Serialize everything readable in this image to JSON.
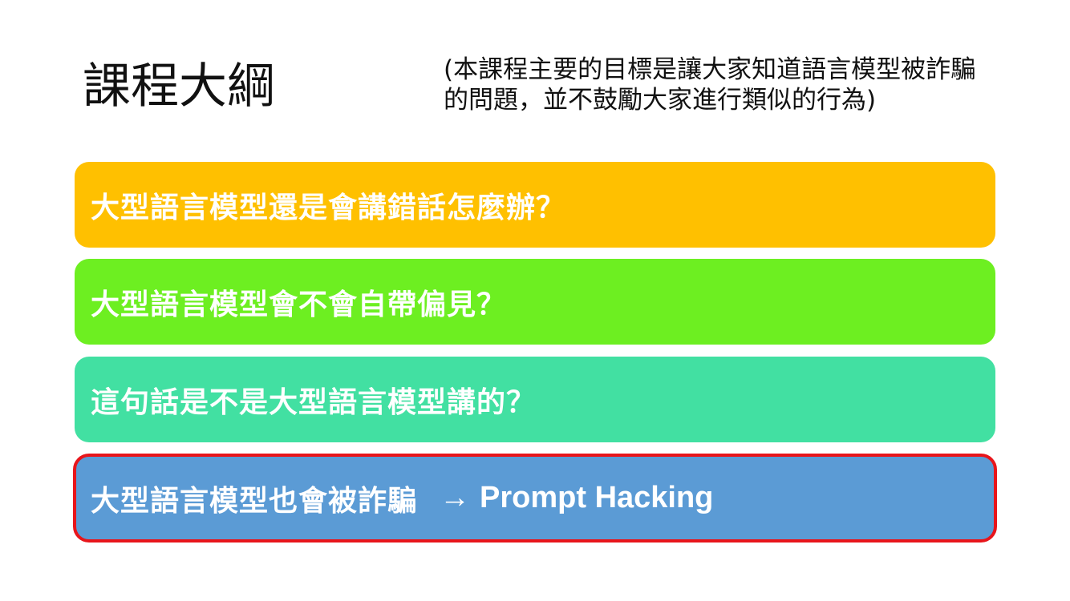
{
  "slide": {
    "title": "課程大綱",
    "note": {
      "line1": "(本課程主要的目標是讓大家知道語言模型被詐騙",
      "line2": "的問題，並不鼓勵大家進行類似的行為)"
    },
    "topics": [
      {
        "label": "大型語言模型還是會講錯話怎麼辦？",
        "color": "#ffc000"
      },
      {
        "label": "大型語言模型會不會自帶偏見？",
        "color": "#6def21"
      },
      {
        "label": "這句話是不是大型語言模型講的？",
        "color": "#42e0a2"
      },
      {
        "label": "大型語言模型也會被詐騙",
        "arrow": "→",
        "extra": "Prompt Hacking",
        "color": "#5b9bd5",
        "highlight_border": "#e8151b"
      }
    ]
  }
}
